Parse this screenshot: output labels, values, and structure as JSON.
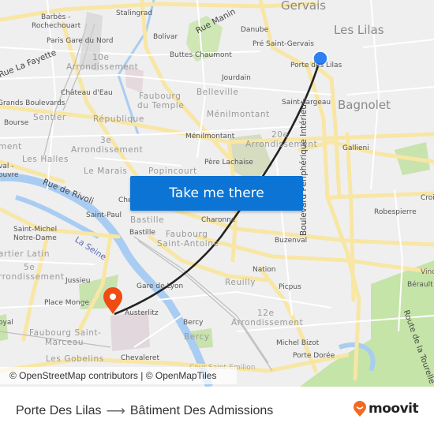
{
  "map": {
    "labels": {
      "gervais": "Gervais",
      "les_lilas": "Les Lilas",
      "bagnolet": "Bagnolet",
      "barbes": "Barbès -",
      "rochechouart": "Rochechouart",
      "stalingrad": "Stalingrad",
      "rue_manin": "Rue Manin",
      "bolivar": "Bolivar",
      "danube": "Danube",
      "pre_saint_gervais": "Pré Saint-Gervais",
      "paris_gare_du_nord": "Paris Gare du Nord",
      "buttes_chaumont": "Buttes Chaumont",
      "porte_des_lilas": "Porte des Lilas",
      "rue_la_fayette": "Rue La Fayette",
      "tenth_num": "10e",
      "tenth_arr": "Arrondissement",
      "jourdain": "Jourdain",
      "chateau_deau": "Château d'Eau",
      "faubourg_du_temple_1": "Faubourg",
      "faubourg_du_temple_2": "du Temple",
      "belleville": "Belleville",
      "saint_fargeau": "Saint-Fargeau",
      "grands_boulevards": "Grands Boulevards",
      "sentier": "Sentier",
      "republique": "République",
      "menilmontant_dist": "Ménilmontant",
      "bourse": "Bourse",
      "menilmontant": "Ménilmontant",
      "twentieth_num": "20e",
      "twentieth_arr": "Arrondissement",
      "gallieni": "Gallieni",
      "third_num": "3e",
      "third_arr": "Arrondissement",
      "arrondissement_left": "ment",
      "pere_lachaise": "Père Lachaise",
      "les_halles": "Les Halles",
      "le_marais": "Le Marais",
      "popincourt": "Popincourt",
      "louvre_1": "val -",
      "louvre_2": "ouvre",
      "rue_de_rivoli": "Rue de Rivoli",
      "chemin_vert": "Che",
      "croix": "Croi",
      "saint_paul": "Saint-Paul",
      "bastille_dist": "Bastille",
      "charonne": "Charonne",
      "robespierre": "Robespierre",
      "bastille": "Bastille",
      "faubourg_st_antoine_1": "Faubourg",
      "faubourg_st_antoine_2": "Saint-Antoine",
      "saint_michel": "Saint-Michel",
      "notre_dame": "Notre-Dame",
      "la_seine": "La Seine",
      "buzenval": "Buzenval",
      "peripherique": "Boulevard Périphérique Intérieur",
      "quartier_latin": "artier Latin",
      "nation": "Nation",
      "vincennes": "Vinc",
      "fifth_num": "5e",
      "fifth_arr": "rrondissement",
      "jussieu": "Jussieu",
      "gare_de_lyon": "Gare de Lyon",
      "reuilly": "Reuilly",
      "picpus": "Picpus",
      "berault": "Bérault",
      "place_monge": "Place Monge",
      "austerlitz": "Austerlitz",
      "twelfth_num": "12e",
      "twelfth_arr": "Arrondissement",
      "route_tourelle": "Route de la Tourelle",
      "royal": "oyal",
      "faubourg_st_marceau_1": "Faubourg Saint-",
      "faubourg_st_marceau_2": "Marceau",
      "bercy_station": "Bercy",
      "bercy_dist": "Bercy",
      "michel_bizot": "Michel Bizot",
      "porte_doree": "Porte Dorée",
      "les_gobelins": "Les Gobelins",
      "chevaleret": "Chevaleret",
      "cour_saint_emilion": "Cour Saint-Emilion"
    },
    "origin_marker": {
      "icon": "origin-dot-icon",
      "color": "#2f80f0"
    },
    "destination_marker": {
      "icon": "map-pin-icon",
      "color": "#ef4b12"
    },
    "route_line_color": "#222222",
    "cta_label": "Take me there",
    "cta_color": "#0b74d4",
    "attribution": "© OpenStreetMap contributors | © OpenMapTiles"
  },
  "footer": {
    "origin": "Porte Des Lilas",
    "arrow_icon": "arrow-right-icon",
    "destination": "Bâtiment Des Admissions",
    "brand": "moovit",
    "brand_color": "#f26a21"
  }
}
